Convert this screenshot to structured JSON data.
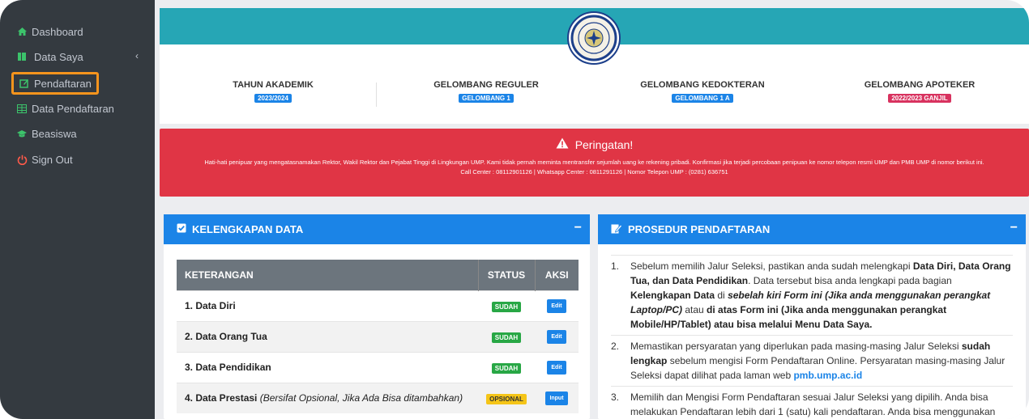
{
  "sidebar": {
    "items": [
      {
        "label": "Dashboard",
        "icon": "home-icon"
      },
      {
        "label": "Data Saya",
        "icon": "book-icon"
      },
      {
        "label": "Pendaftaran",
        "icon": "edit-icon"
      },
      {
        "label": "Data Pendaftaran",
        "icon": "table-icon"
      },
      {
        "label": "Beasiswa",
        "icon": "graduation-cap-icon"
      },
      {
        "label": "Sign Out",
        "icon": "power-icon"
      }
    ]
  },
  "info": {
    "cols": [
      {
        "title": "TAHUN AKADEMIK",
        "badge": "2023/2024"
      },
      {
        "title": "GELOMBANG REGULER",
        "badge": "GELOMBANG 1"
      },
      {
        "title": "GELOMBANG KEDOKTERAN",
        "badge": "GELOMBANG 1 A"
      },
      {
        "title": "GELOMBANG APOTEKER",
        "badge": "2022/2023 GANJIL"
      }
    ]
  },
  "alert": {
    "title": "Peringatan!",
    "message": "Hati-hati penipuar yang mengatasnamakan Rektor, Wakil Rektor dan Pejabat Tinggi di Lingkungan UMP. Kami tidak pernah meminta mentransfer sejumlah uang ke rekening pribadi. Konfirmasi jika terjadi percobaan penipuan ke nomor telepon resmi UMP dan PMB UMP di nomor berikut ini.",
    "contacts": "Call Center : 08112901126 | Whatsapp Center : 0811291126 | Nomor Telepon UMP : (0281) 636751"
  },
  "kelengkapan": {
    "title": "KELENGKAPAN DATA",
    "headers": {
      "keterangan": "KETERANGAN",
      "status": "STATUS",
      "aksi": "AKSI"
    },
    "rows": [
      {
        "label": "1. Data Diri",
        "note": "",
        "status": "SUDAH",
        "action": "Edit"
      },
      {
        "label": "2. Data Orang Tua",
        "note": "",
        "status": "SUDAH",
        "action": "Edit"
      },
      {
        "label": "3. Data Pendidikan",
        "note": "",
        "status": "SUDAH",
        "action": "Edit"
      },
      {
        "label": "4. Data Prestasi",
        "note": "(Bersifat Opsional, Jika Ada Bisa ditambahkan)",
        "status": "OPSIONAL",
        "action": "Input"
      }
    ]
  },
  "prosedur": {
    "title": "PROSEDUR PENDAFTARAN",
    "items": [
      {
        "num": "1.",
        "p1": "Sebelum memilih Jalur Seleksi, pastikan anda sudah melengkapi ",
        "b1": "Data Diri, Data Orang Tua, dan Data Pendidikan",
        "p2": ". Data tersebut bisa anda lengkapi pada bagian ",
        "b2": "Kelengkapan Data",
        "p3": " di ",
        "b3": "sebelah kiri Form ini (Jika anda menggunakan perangkat Laptop/PC)",
        "p4": " atau ",
        "b4": "di atas Form ini (Jika anda menggunakan perangkat Mobile/HP/Tablet) atau bisa melalui Menu Data Saya."
      },
      {
        "num": "2.",
        "p1": "Memastikan persyaratan yang diperlukan pada masing-masing Jalur Seleksi ",
        "b1": "sudah lengkap",
        "p2": " sebelum mengisi Form Pendaftaran Online. Persyaratan masing-masing Jalur Seleksi dapat dilihat pada laman web ",
        "link": "pmb.ump.ac.id"
      },
      {
        "num": "3.",
        "p1": "Memilih dan Mengisi Form Pendaftaran sesuai Jalur Seleksi yang dipilih. Anda bisa melakukan Pendaftaran lebih dari 1 (satu) kali pendaftaran. Anda bisa menggunakan Jalur"
      }
    ]
  },
  "colors": {
    "sidebar": "#343a40",
    "teal": "#26a6b5",
    "blue": "#1b84e7",
    "red": "#e03545",
    "highlight": "#f7941d"
  }
}
